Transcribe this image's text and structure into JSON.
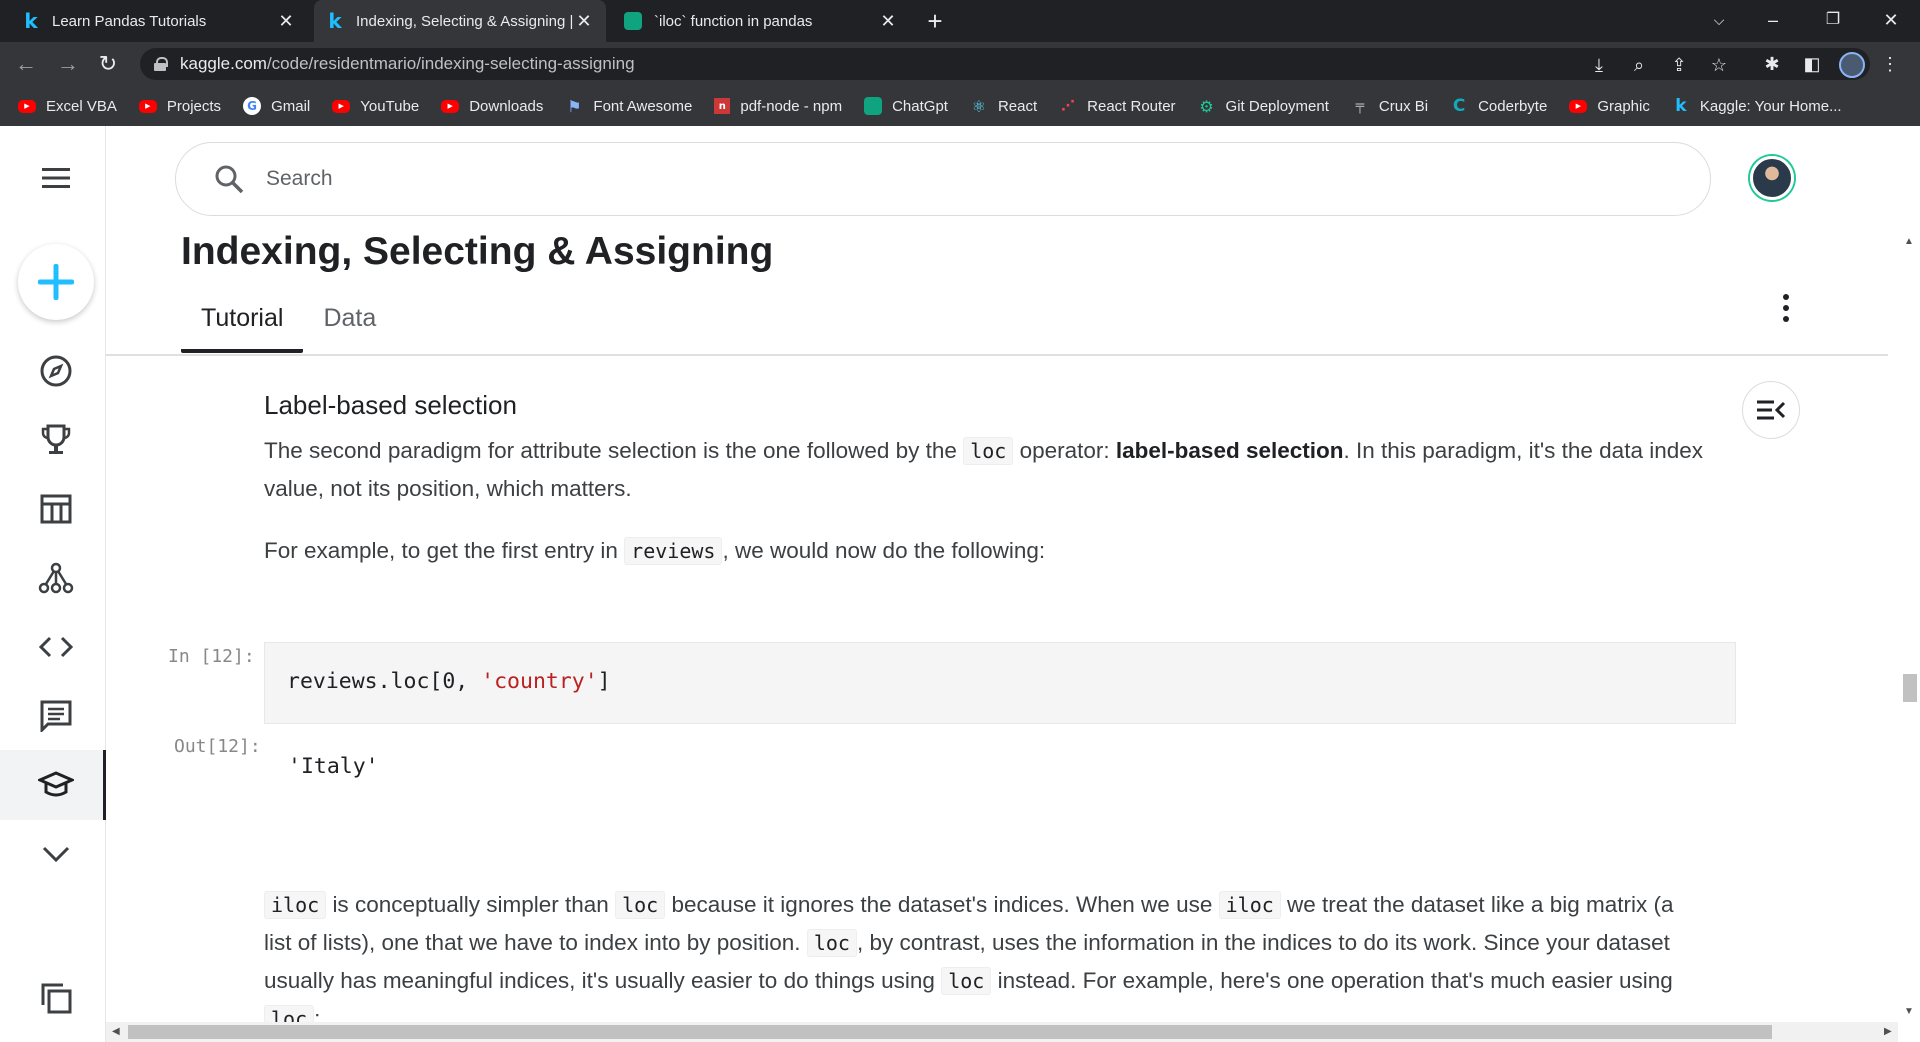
{
  "browser": {
    "tabs": [
      {
        "title": "Learn Pandas Tutorials",
        "favicon": "kaggle-icon"
      },
      {
        "title": "Indexing, Selecting & Assigning |",
        "favicon": "kaggle-icon"
      },
      {
        "title": "`iloc` function in pandas",
        "favicon": "chatgpt-icon"
      }
    ],
    "url_host": "kaggle.com",
    "url_path": "/code/residentmario/indexing-selecting-assigning",
    "bookmarks": [
      {
        "label": "Excel VBA",
        "icon": "youtube-icon"
      },
      {
        "label": "Projects",
        "icon": "youtube-icon"
      },
      {
        "label": "Gmail",
        "icon": "google-icon"
      },
      {
        "label": "YouTube",
        "icon": "youtube-icon"
      },
      {
        "label": "Downloads",
        "icon": "youtube-icon"
      },
      {
        "label": "Font Awesome",
        "icon": "flag-icon"
      },
      {
        "label": "pdf-node - npm",
        "icon": "npm-icon"
      },
      {
        "label": "ChatGpt",
        "icon": "chatgpt-icon"
      },
      {
        "label": "React",
        "icon": "react-icon"
      },
      {
        "label": "React Router",
        "icon": "react-router-icon"
      },
      {
        "label": "Git Deployment",
        "icon": "git-icon"
      },
      {
        "label": "Crux Bi",
        "icon": "crux-icon"
      },
      {
        "label": "Coderbyte",
        "icon": "coderbyte-icon"
      },
      {
        "label": "Graphic",
        "icon": "youtube-icon"
      },
      {
        "label": "Kaggle: Your Home...",
        "icon": "kaggle-icon"
      }
    ]
  },
  "search": {
    "placeholder": "Search"
  },
  "page": {
    "title": "Indexing, Selecting & Assigning",
    "tabs": [
      "Tutorial",
      "Data"
    ],
    "section_heading": "Label-based selection",
    "para1": {
      "a": "The second paradigm for attribute selection is the one followed by the",
      "code1": "loc",
      "b": "operator:",
      "bold": "label-based selection",
      "c": ". In this paradigm, it's the data index value, not its position, which matters."
    },
    "para2": {
      "a": "For example, to get the first entry in",
      "code1": "reviews",
      "b": ", we would now do the following:"
    },
    "cell_in_prompt": "In [12]:",
    "cell_code_a": "reviews.loc[0, ",
    "cell_code_str": "'country'",
    "cell_code_b": "]",
    "cell_out_prompt": "Out[12]:",
    "cell_output": "'Italy'",
    "para3": {
      "code1": "iloc",
      "a": "is conceptually simpler than",
      "code2": "loc",
      "b": "because it ignores the dataset's indices. When we use",
      "code3": "iloc",
      "c": "we treat the dataset like a big matrix (a list of lists), one that we have to index into by position.",
      "code4": "loc",
      "d": ", by contrast, uses the information in the indices to do its work. Since your dataset usually has meaningful indices, it's usually easier to do things using",
      "code5": "loc",
      "e": "instead. For example, here's one operation that's much easier using",
      "code6": "loc",
      "f": ":"
    }
  },
  "colors": {
    "accent": "#20beff",
    "create_plus": "#20beff"
  }
}
